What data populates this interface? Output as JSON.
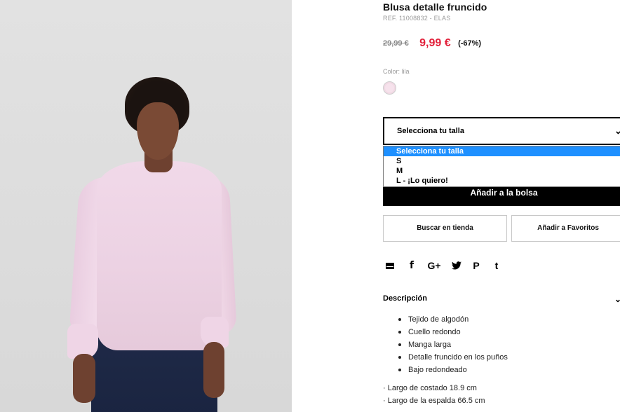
{
  "product": {
    "title": "Blusa detalle fruncido",
    "ref": "REF. 11008832 - ELAS",
    "old_price": "29,99 €",
    "new_price": "9,99 €",
    "discount": "(-67%)",
    "color_label": "Color: lila",
    "color_hex": "#f1d9e4"
  },
  "size_select": {
    "label": "Selecciona tu talla",
    "options": [
      "Selecciona tu talla",
      "S",
      "M",
      "L - ¡Lo quiero!"
    ],
    "selected_index": 0
  },
  "actions": {
    "add_to_bag": "Añadir a la bolsa",
    "find_in_store": "Buscar en tienda",
    "add_to_favorites": "Añadir a Favoritos"
  },
  "share": {
    "icons": [
      "mail-icon",
      "facebook-icon",
      "google-plus-icon",
      "twitter-icon",
      "pinterest-icon",
      "tumblr-icon"
    ],
    "glyphs": {
      "facebook": "f",
      "google_plus": "G+",
      "twitter": "🐦",
      "pinterest": "P",
      "tumblr": "t"
    }
  },
  "description": {
    "heading": "Descripción",
    "items": [
      "Tejido de algodón",
      "Cuello redondo",
      "Manga larga",
      "Detalle fruncido en los puños",
      "Bajo redondeado"
    ],
    "measurements": [
      "· Largo de costado 18.9 cm",
      "· Largo de la espalda 66.5 cm"
    ]
  },
  "colors": {
    "accent_red": "#e2203a",
    "select_highlight": "#1e90ff",
    "button_black": "#000000"
  }
}
